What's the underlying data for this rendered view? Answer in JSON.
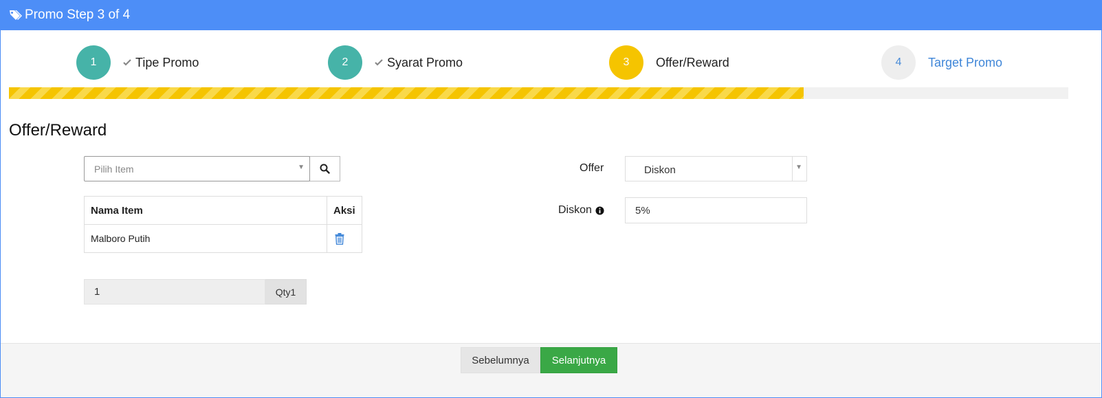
{
  "header": {
    "title": "Promo Step 3 of 4",
    "icon": "tags-icon"
  },
  "steps": [
    {
      "number": "1",
      "label": "Tipe Promo",
      "status": "done"
    },
    {
      "number": "2",
      "label": "Syarat Promo",
      "status": "done"
    },
    {
      "number": "3",
      "label": "Offer/Reward",
      "status": "active"
    },
    {
      "number": "4",
      "label": "Target Promo",
      "status": "pending"
    }
  ],
  "progress": {
    "percent": 75
  },
  "section": {
    "title": "Offer/Reward"
  },
  "item_select": {
    "placeholder": "Pilih Item"
  },
  "items_table": {
    "headers": [
      "Nama Item",
      "Aksi"
    ],
    "rows": [
      {
        "name": "Malboro Putih",
        "action_icon": "trash-icon"
      }
    ]
  },
  "qty": {
    "value": "1",
    "addon": "Qty1"
  },
  "offer": {
    "label": "Offer",
    "value": "Diskon"
  },
  "diskon": {
    "label": "Diskon",
    "value": "5%"
  },
  "footer": {
    "prev_label": "Sebelumnya",
    "next_label": "Selanjutnya"
  },
  "colors": {
    "header_bg": "#4d8ef7",
    "step_done": "#46b3a8",
    "step_active": "#f5c400",
    "step_pending": "#eeeeee",
    "next_button": "#3aa846"
  }
}
